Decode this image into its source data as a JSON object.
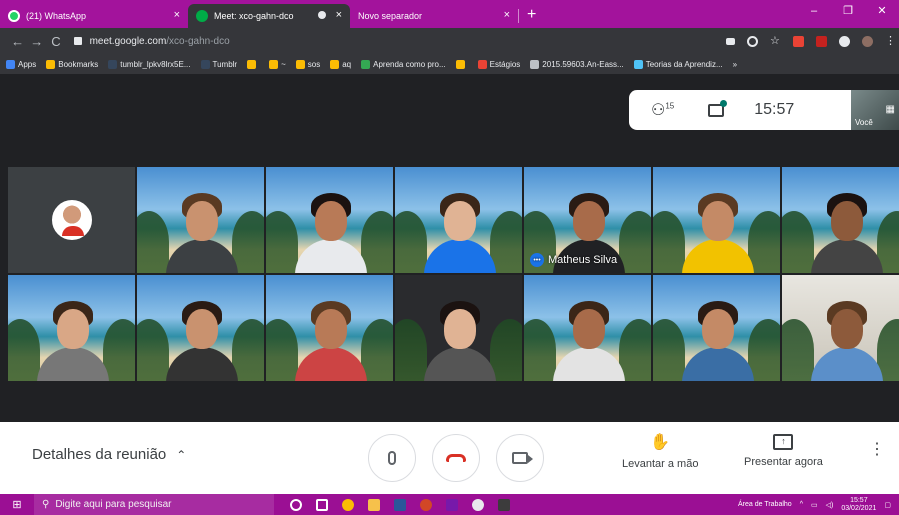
{
  "browser": {
    "tabs": [
      {
        "title": "(21) WhatsApp",
        "close": "×"
      },
      {
        "title": "Meet: xco-gahn-dco",
        "close": "×"
      },
      {
        "title": "Novo separador",
        "close": "×"
      }
    ],
    "new_tab": "+",
    "window_controls": [
      "–",
      "❐",
      "✕"
    ],
    "nav": {
      "back": "←",
      "forward": "→",
      "reload": "C"
    },
    "url_host": "meet.google.com",
    "url_path": "/xco-gahn-dco",
    "bookmarks": [
      {
        "label": "Apps",
        "color": "#4285f4"
      },
      {
        "label": "Bookmarks",
        "color": "#fbbc04"
      },
      {
        "label": "tumblr_lpkv8lrx5E...",
        "color": "#35465c"
      },
      {
        "label": "Tumblr",
        "color": "#35465c"
      },
      {
        "label": "",
        "color": "#fbbc04"
      },
      {
        "label": "~",
        "color": "#fbbc04"
      },
      {
        "label": "sos",
        "color": "#fbbc04"
      },
      {
        "label": "aq",
        "color": "#fbbc04"
      },
      {
        "label": "Aprenda como pro...",
        "color": "#34a853"
      },
      {
        "label": "",
        "color": "#fbbc04"
      },
      {
        "label": "Estágios",
        "color": "#ea4335"
      },
      {
        "label": "2015.59603.An-Eass...",
        "color": "#bdc1c6"
      },
      {
        "label": "Teorias da Aprendiz...",
        "color": "#4fc3f7"
      },
      {
        "label": "»",
        "color": ""
      }
    ]
  },
  "meet": {
    "participants_count": "15",
    "clock": "15:57",
    "self_label": "Você",
    "active_speaker": "Matheus Silva",
    "meeting_details": "Detalhes da reunião",
    "raise_hand": "Levantar a mão",
    "present_now": "Presentar agora",
    "colors": {
      "accent": "#1a73e8",
      "end_call": "#d93025",
      "chat_dot": "#00796b"
    }
  },
  "taskbar": {
    "search_placeholder": "Digite aqui para pesquisar",
    "work_area": "Área de Trabalho",
    "time": "15:57",
    "date": "03/02/2021"
  }
}
